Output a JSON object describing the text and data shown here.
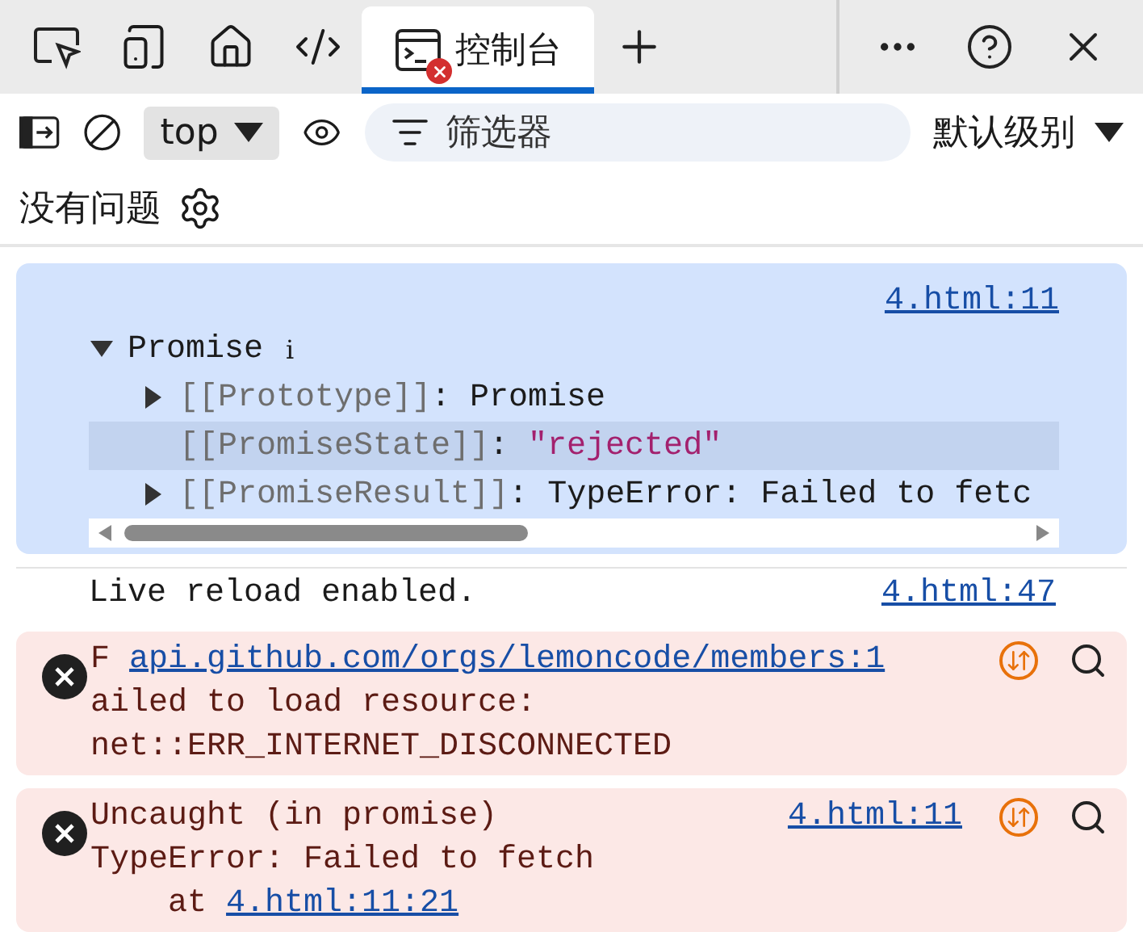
{
  "tabs": [
    {
      "kind": "inspect",
      "selected": false,
      "error_badge": false
    },
    {
      "kind": "device",
      "selected": false,
      "error_badge": false
    },
    {
      "kind": "home",
      "selected": false,
      "error_badge": false
    },
    {
      "kind": "sources",
      "selected": false,
      "error_badge": false
    },
    {
      "kind": "console",
      "label": "控制台",
      "selected": true,
      "error_badge": true
    }
  ],
  "toolbar": {
    "context": "top",
    "filter": {
      "placeholder": "筛选器"
    },
    "level": "默认级别"
  },
  "issues": {
    "text": "没有问题"
  },
  "messages": [
    {
      "kind": "object",
      "source": "4.html:11",
      "label": "Promise",
      "badge": "i",
      "expanded": true,
      "properties": [
        {
          "kind": "object",
          "key": "[[Prototype]]",
          "colon": ":",
          "value": "Promise",
          "expandable": true,
          "highlighted": false
        },
        {
          "kind": "string",
          "key": "[[PromiseState]]",
          "colon": ":",
          "value": "\"rejected\"",
          "expandable": false,
          "highlighted": true
        },
        {
          "kind": "object",
          "key": "[[PromiseResult]]",
          "colon": ":",
          "value": "TypeError: Failed to fetc",
          "expandable": true,
          "highlighted": false
        }
      ]
    },
    {
      "kind": "log",
      "text": "Live reload enabled.",
      "source": "4.html:47"
    },
    {
      "kind": "error",
      "lines": [
        [
          {
            "text": "F "
          },
          {
            "text": "api.github.com/orgs/lemoncode/members:1",
            "link": true
          }
        ],
        [
          {
            "text": "ailed to load resource:"
          }
        ],
        [
          {
            "text": "net::ERR_INTERNET_DISCONNECTED"
          }
        ]
      ]
    },
    {
      "kind": "error",
      "source": "4.html:11",
      "lines": [
        [
          {
            "text": "Uncaught (in promise)"
          }
        ],
        [
          {
            "text": "TypeError: Failed to fetch"
          }
        ],
        [
          {
            "text": "    at "
          },
          {
            "text": "4.html:11:21",
            "link": true
          }
        ]
      ]
    }
  ]
}
